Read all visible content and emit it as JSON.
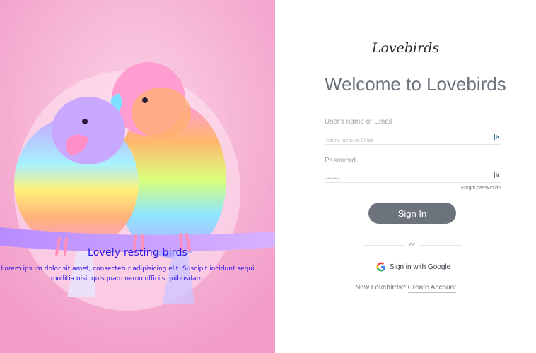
{
  "hero": {
    "title": "Lovely resting birds",
    "text": "Lorem ipsum dolor sit amet, consectetur adipisicing elit. Suscipit incidunt sequi mollitia nisi, quisquam nemo officiis quibusdam."
  },
  "login": {
    "brand": "Lovebirds",
    "heading": "Welcome to Lovebirds",
    "username": {
      "label": "User's name or Email",
      "placeholder": "User's name or Email",
      "value": ""
    },
    "password": {
      "label": "Password",
      "placeholder": "••••••••",
      "value": ""
    },
    "forgot_label": "Forgot password?",
    "signin_label": "Sign In",
    "divider_label": "or",
    "google_label": "Sign in with Google",
    "create_prompt": "New Lovebirds?",
    "create_link": "Create Account"
  },
  "colors": {
    "accent": "#6c737c",
    "hero_caption": "#2a14e6",
    "heading": "#6a727c"
  },
  "icons": {
    "field_icon": "input-key-icon",
    "google_icon": "google-g-icon"
  }
}
